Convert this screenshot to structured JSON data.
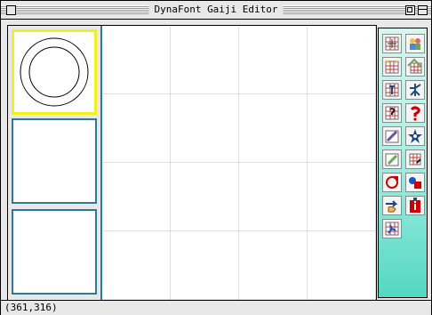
{
  "window": {
    "title": "DynaFont Gaiji Editor"
  },
  "status": {
    "cursor_position": "(361,316)"
  },
  "glyph_slots": [
    {
      "name": "glyph-slot-1",
      "selected": true
    },
    {
      "name": "glyph-slot-2",
      "selected": false
    },
    {
      "name": "glyph-slot-3",
      "selected": false
    }
  ],
  "tools": [
    {
      "icon": "grid-add-icon"
    },
    {
      "icon": "people-swap-icon"
    },
    {
      "icon": "grid-sparkle-icon"
    },
    {
      "icon": "grid-arrow-icon"
    },
    {
      "icon": "grid-text-icon"
    },
    {
      "icon": "kanji-icon"
    },
    {
      "icon": "grid-question-icon"
    },
    {
      "icon": "question-icon"
    },
    {
      "icon": "pen-icon"
    },
    {
      "icon": "star-icon"
    },
    {
      "icon": "pencil-icon"
    },
    {
      "icon": "grid-edit-icon"
    },
    {
      "icon": "rotate-icon"
    },
    {
      "icon": "shapes-icon"
    },
    {
      "icon": "hand-arrow-icon"
    },
    {
      "icon": "info-icon"
    },
    {
      "icon": "exit-icon"
    }
  ],
  "colors": {
    "highlight": "#f2f020",
    "accent": "#2a7b9a",
    "palette_top": "#d9f6f0",
    "palette_bottom": "#53d8c3"
  }
}
